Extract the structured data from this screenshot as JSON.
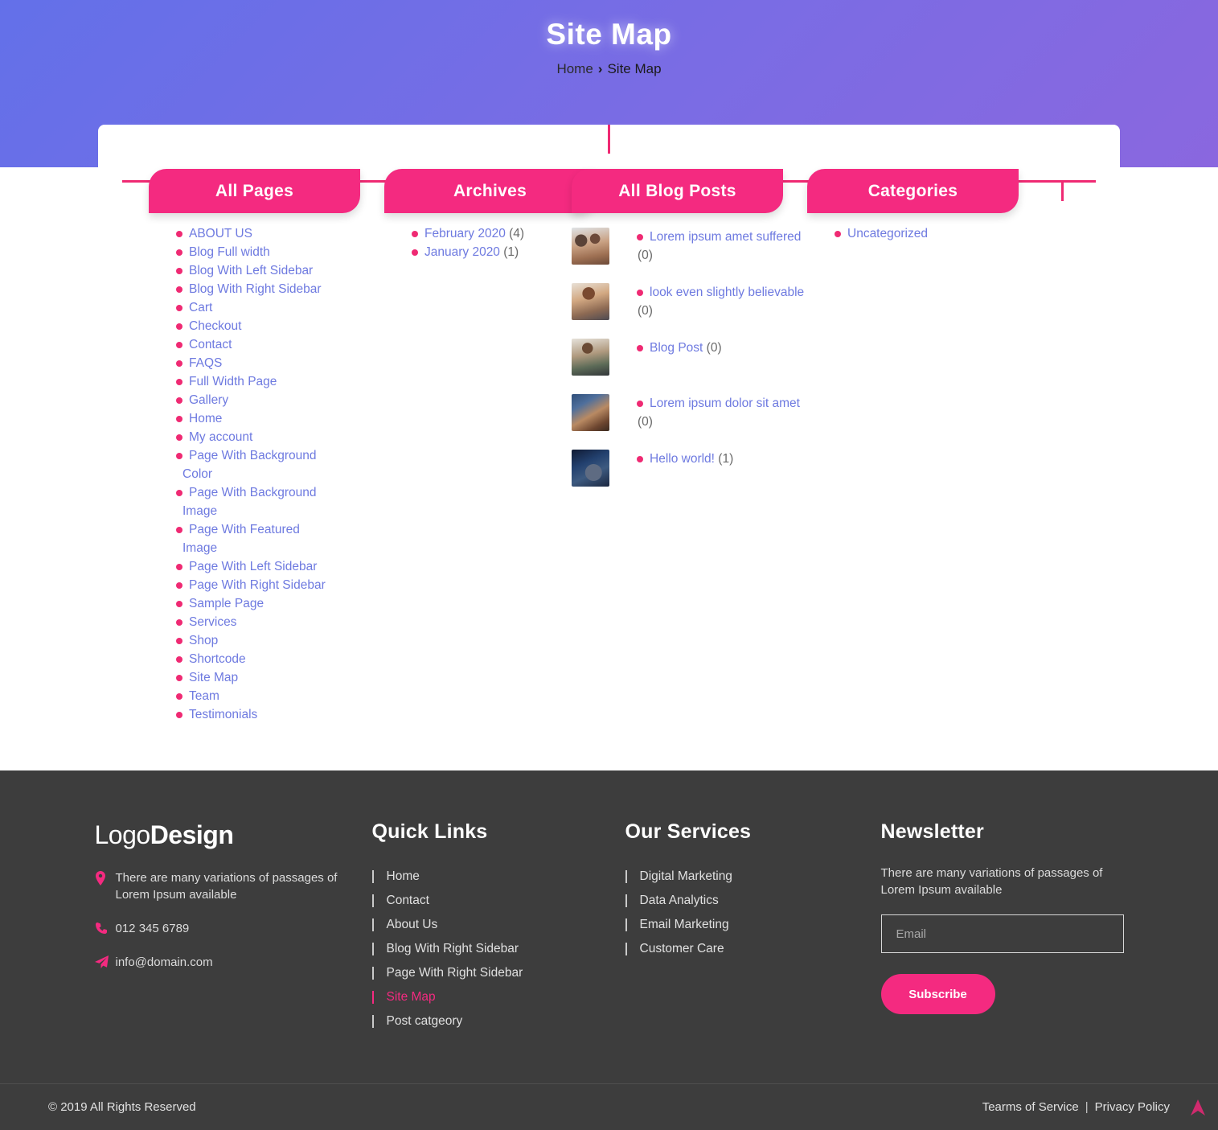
{
  "hero": {
    "title": "Site Map",
    "breadcrumb_home": "Home",
    "breadcrumb_sep": "›",
    "breadcrumb_current": "Site Map"
  },
  "colors": {
    "accent_pink": "#f42a80",
    "link_blue": "#6e7ae0",
    "hero_gradient_start": "#6370e9",
    "hero_gradient_end": "#8a67df",
    "footer_bg": "#3d3d3d"
  },
  "sitemap": {
    "pages": {
      "title": "All Pages",
      "items": [
        {
          "label": "ABOUT US"
        },
        {
          "label": "Blog Full width"
        },
        {
          "label": "Blog With Left Sidebar"
        },
        {
          "label": "Blog With Right Sidebar"
        },
        {
          "label": "Cart"
        },
        {
          "label": "Checkout"
        },
        {
          "label": "Contact"
        },
        {
          "label": "FAQS"
        },
        {
          "label": "Full Width Page"
        },
        {
          "label": "Gallery"
        },
        {
          "label": "Home"
        },
        {
          "label": "My account"
        },
        {
          "label": "Page With Background Color"
        },
        {
          "label": "Page With Background Image"
        },
        {
          "label": "Page With Featured Image"
        },
        {
          "label": "Page With Left Sidebar"
        },
        {
          "label": "Page With Right Sidebar"
        },
        {
          "label": "Sample Page"
        },
        {
          "label": "Services"
        },
        {
          "label": "Shop"
        },
        {
          "label": "Shortcode"
        },
        {
          "label": "Site Map"
        },
        {
          "label": "Team"
        },
        {
          "label": "Testimonials"
        }
      ]
    },
    "archives": {
      "title": "Archives",
      "items": [
        {
          "label": "February 2020",
          "count": "(4)"
        },
        {
          "label": "January 2020",
          "count": "(1)"
        }
      ]
    },
    "posts": {
      "title": "All Blog Posts",
      "items": [
        {
          "label": "Lorem ipsum amet suffered",
          "count": "(0)",
          "thumb": "office-couple-photo"
        },
        {
          "label": "look even slightly believable",
          "count": "(0)",
          "thumb": "woman-desk-photo"
        },
        {
          "label": "Blog Post",
          "count": "(0)",
          "thumb": "man-laptop-photo"
        },
        {
          "label": "Lorem ipsum dolor sit amet",
          "count": "(0)",
          "thumb": "tablet-desk-photo"
        },
        {
          "label": "Hello world!",
          "count": "(1)",
          "thumb": "keyboard-photo"
        }
      ]
    },
    "categories": {
      "title": "Categories",
      "items": [
        {
          "label": "Uncategorized"
        }
      ]
    }
  },
  "footer": {
    "logo_light": "Logo",
    "logo_bold": "Design",
    "address": "There are many variations of passages of Lorem Ipsum available",
    "phone": "012 345 6789",
    "email": "info@domain.com",
    "quick_links": {
      "title": "Quick Links",
      "items": [
        {
          "label": "Home",
          "active": false
        },
        {
          "label": "Contact",
          "active": false
        },
        {
          "label": "About Us",
          "active": false
        },
        {
          "label": "Blog With Right Sidebar",
          "active": false
        },
        {
          "label": "Page With Right Sidebar",
          "active": false
        },
        {
          "label": "Site Map",
          "active": true
        },
        {
          "label": "Post catgeory",
          "active": false
        }
      ]
    },
    "services": {
      "title": "Our Services",
      "items": [
        {
          "label": "Digital Marketing"
        },
        {
          "label": "Data Analytics"
        },
        {
          "label": "Email Marketing"
        },
        {
          "label": "Customer Care"
        }
      ]
    },
    "newsletter": {
      "title": "Newsletter",
      "text": "There are many variations of passages of Lorem Ipsum available",
      "email_placeholder": "Email",
      "email_value": "",
      "subscribe_label": "Subscribe"
    },
    "bottom": {
      "copyright": "© 2019 All Rights Reserved",
      "terms": "Tearms of Service",
      "separator": "|",
      "privacy": "Privacy Policy"
    }
  }
}
